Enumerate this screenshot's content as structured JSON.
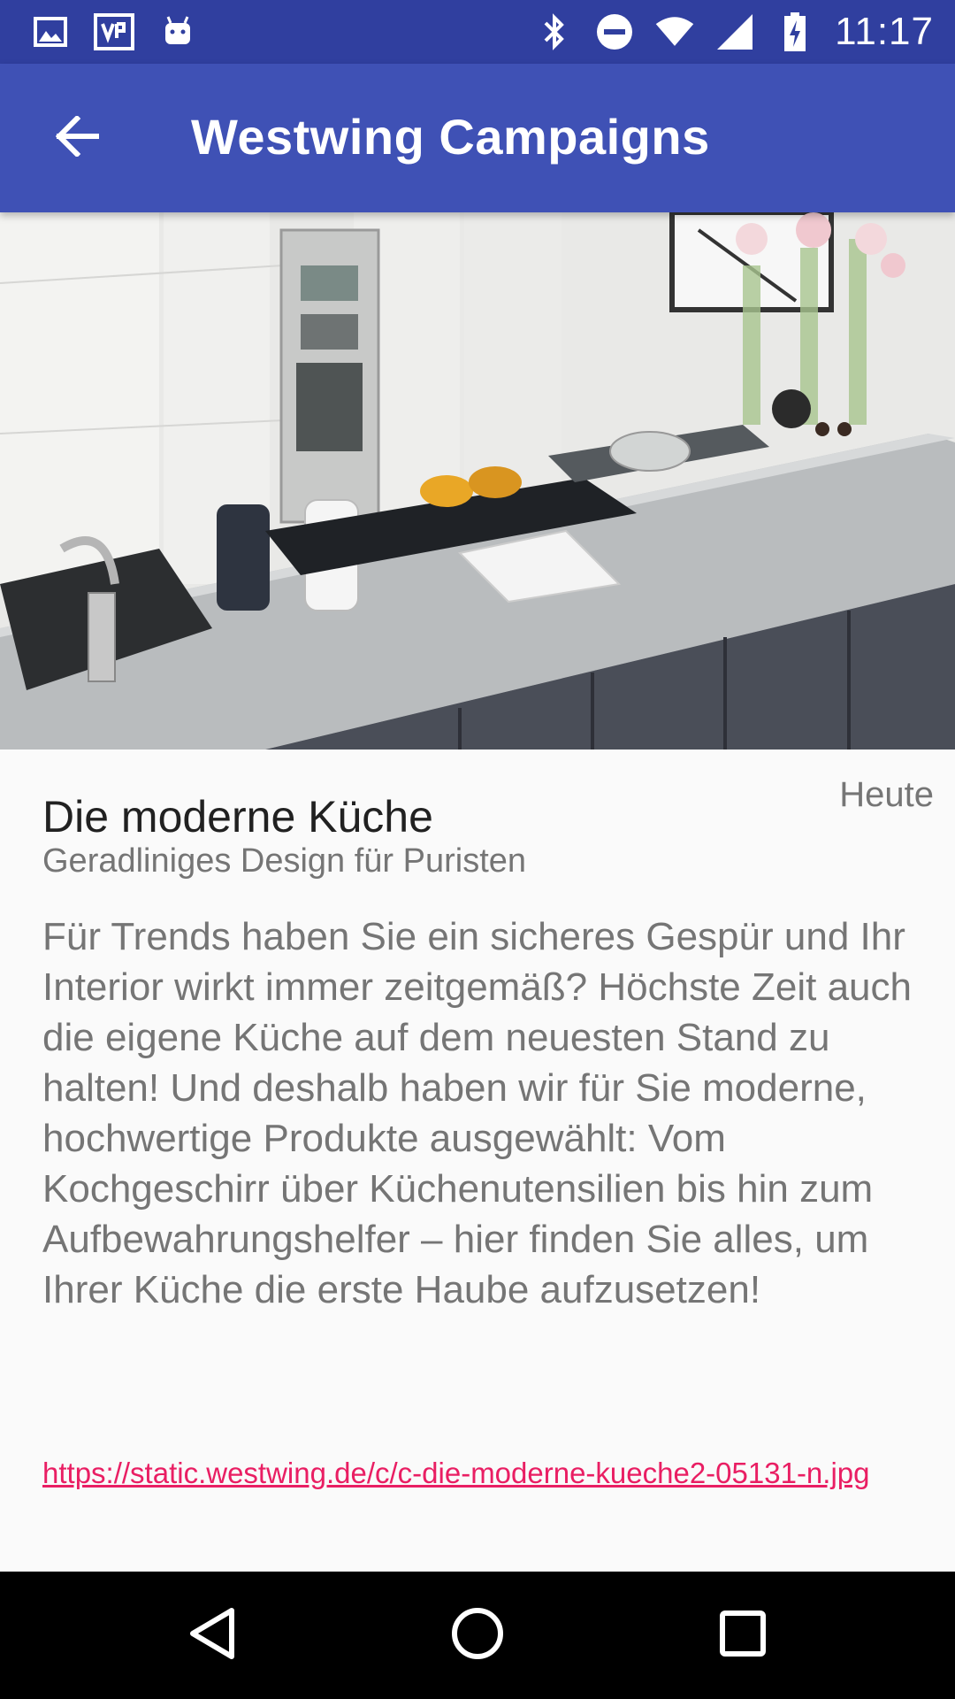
{
  "status_bar": {
    "time": "11:17",
    "left_icons": [
      "image-icon",
      "sync-app-icon",
      "android-debug-icon"
    ],
    "right_icons": [
      "bluetooth-icon",
      "do-not-disturb-icon",
      "wifi-icon",
      "signal-icon",
      "battery-charging-icon"
    ],
    "background": "#303f9f"
  },
  "app_bar": {
    "title": "Westwing Campaigns",
    "back_icon": "arrow-back-icon",
    "background": "#3f51b5"
  },
  "campaign": {
    "image": "kitchen-photo",
    "date": "Heute",
    "title": "Die moderne Küche",
    "subtitle": "Geradliniges Design für Puristen",
    "description": "Für Trends haben Sie ein sicheres Gespür und Ihr Interior wirkt immer zeitgemäß? Höchste Zeit auch die eigene Küche auf dem neuesten Stand zu halten! Und deshalb haben wir für Sie moderne, hochwertige Produkte ausgewählt: Vom Kochgeschirr über Küchenutensilien bis hin zum Aufbewahrungshelfer – hier finden Sie alles, um Ihrer Küche die erste Haube aufzusetzen!",
    "link": "https://static.westwing.de/c/c-die-moderne-kueche2-05131-n.jpg",
    "link_color": "#e91e63"
  },
  "nav_bar": {
    "buttons": [
      "back-triangle-icon",
      "home-circle-icon",
      "recents-square-icon"
    ]
  }
}
